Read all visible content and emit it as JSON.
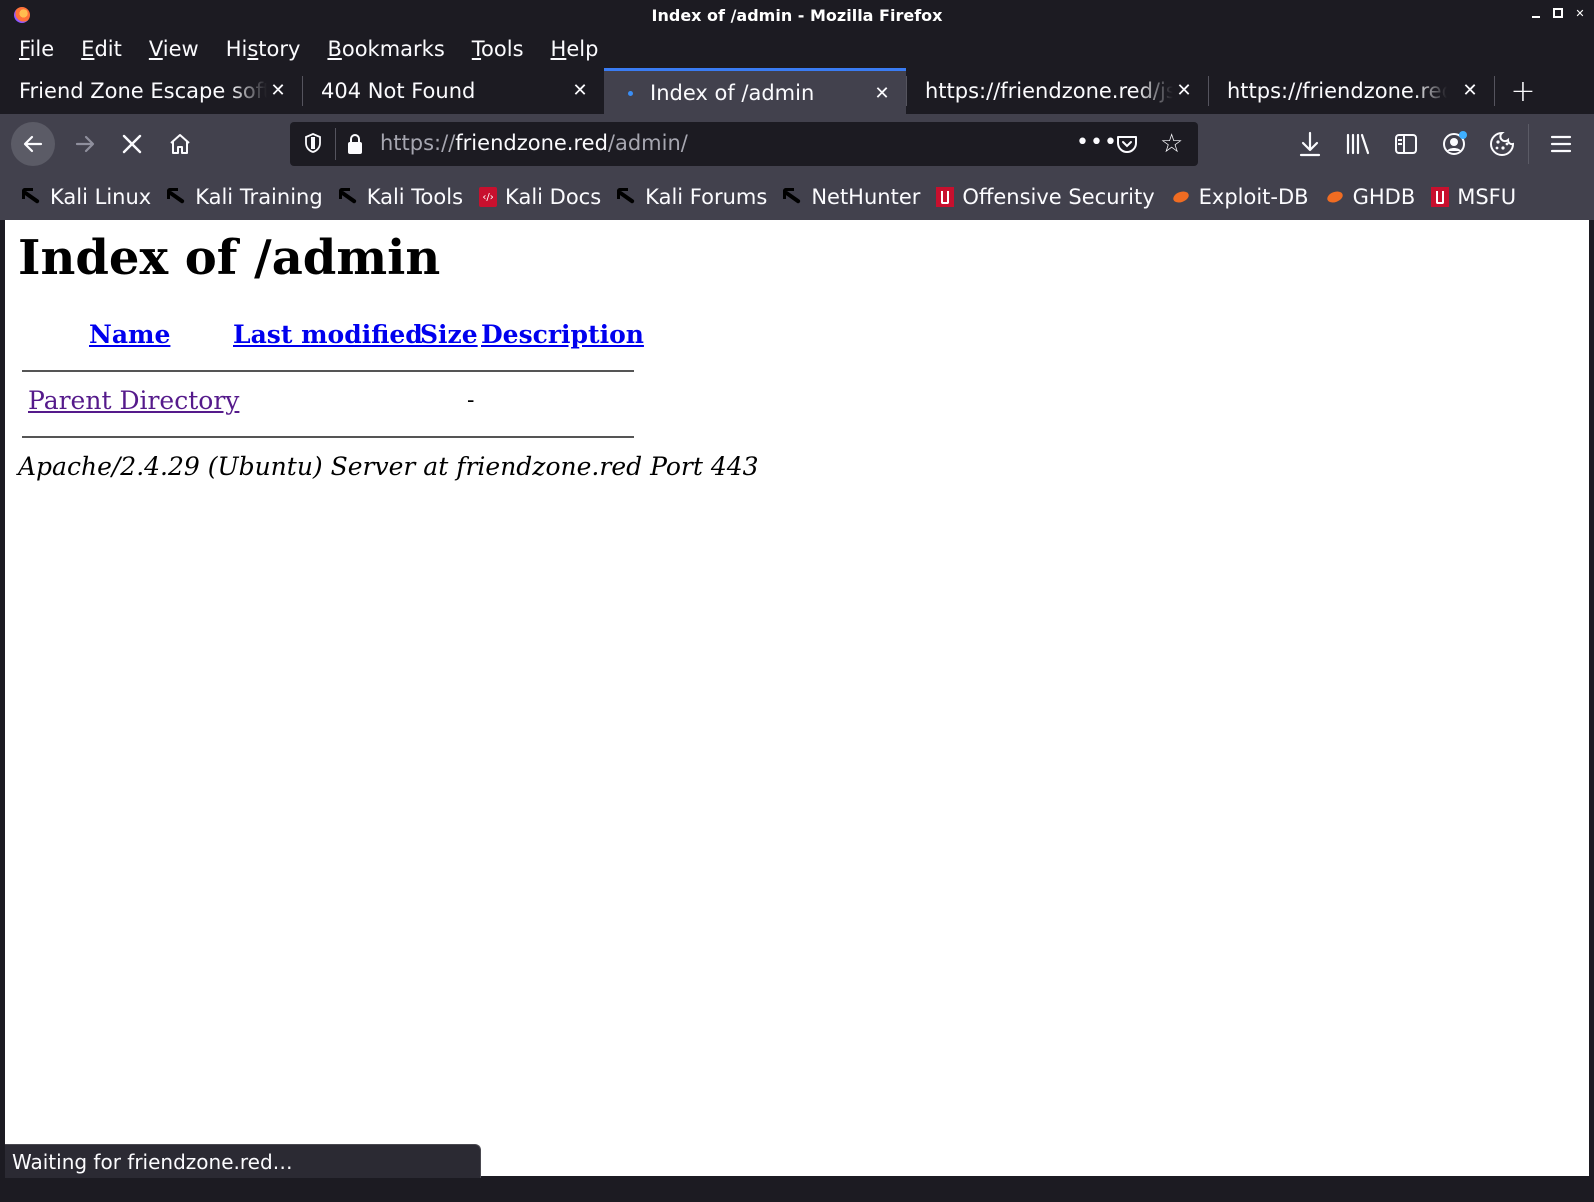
{
  "window": {
    "title": "Index of /admin - Mozilla Firefox"
  },
  "menu": [
    {
      "label": "File"
    },
    {
      "label": "Edit"
    },
    {
      "label": "View"
    },
    {
      "label": "History"
    },
    {
      "label": "Bookmarks"
    },
    {
      "label": "Tools"
    },
    {
      "label": "Help"
    }
  ],
  "tabs": [
    {
      "label": "Friend Zone Escape software",
      "active": false
    },
    {
      "label": "404 Not Found",
      "active": false
    },
    {
      "label": "Index of /admin",
      "active": true
    },
    {
      "label": "https://friendzone.red/js/js/",
      "active": false
    },
    {
      "label": "https://friendzone.red/",
      "active": false
    }
  ],
  "url": {
    "scheme": "https://",
    "host": "friendzone.red",
    "path": "/admin/"
  },
  "bookmarks": [
    {
      "label": "Kali Linux",
      "icon": "kali-dragon-icon"
    },
    {
      "label": "Kali Training",
      "icon": "kali-dragon-icon"
    },
    {
      "label": "Kali Tools",
      "icon": "kali-dragon-icon"
    },
    {
      "label": "Kali Docs",
      "icon": "kali-docs-icon"
    },
    {
      "label": "Kali Forums",
      "icon": "kali-dragon-icon"
    },
    {
      "label": "NetHunter",
      "icon": "kali-dragon-icon"
    },
    {
      "label": "Offensive Security",
      "icon": "offsec-icon"
    },
    {
      "label": "Exploit-DB",
      "icon": "exploit-db-icon"
    },
    {
      "label": "GHDB",
      "icon": "exploit-db-icon"
    },
    {
      "label": "MSFU",
      "icon": "offsec-icon"
    }
  ],
  "page": {
    "heading": "Index of /admin",
    "columns": {
      "name": "Name",
      "last_modified": "Last modified",
      "size": "Size",
      "description": "Description"
    },
    "rows": [
      {
        "name": "Parent Directory",
        "size": "-"
      }
    ],
    "address": "Apache/2.4.29 (Ubuntu) Server at friendzone.red Port 443"
  },
  "status": {
    "text": "Waiting for friendzone.red…"
  },
  "colors": {
    "chrome_dark": "#1c1b22",
    "toolbar": "#42414d",
    "active_tab_accent": "#3a7cf3",
    "link": "#0000ee",
    "visited_link": "#551a8b"
  }
}
